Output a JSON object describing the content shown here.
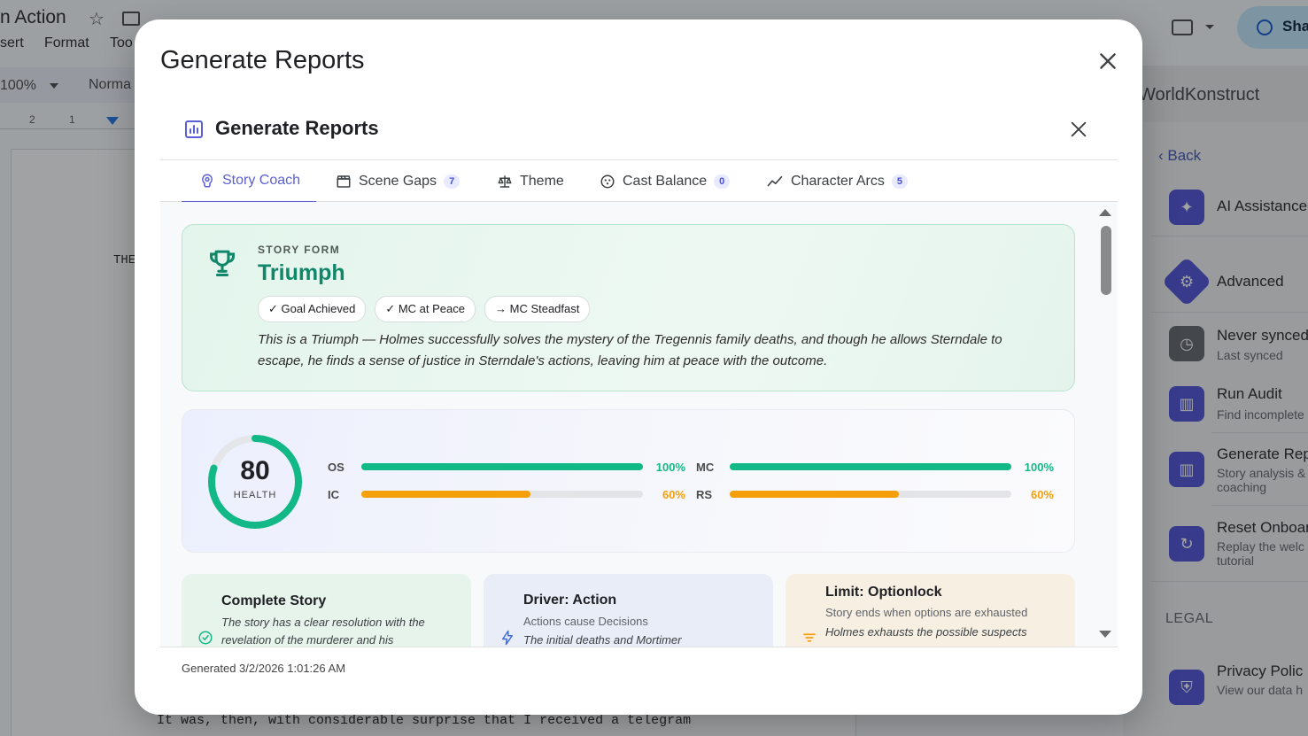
{
  "background": {
    "doc_title": "n Action",
    "menu": [
      "sert",
      "Format",
      "Too"
    ],
    "zoom": "100%",
    "style": "Norma",
    "ruler_numbers": [
      "2",
      "1"
    ],
    "page_line_1": "THE",
    "page_line_2": "It was, then, with considerable surprise that I received a telegram",
    "share_label": "Sha"
  },
  "side_panel": {
    "title": "WorldKonstruct",
    "back_label": "Back",
    "items": [
      {
        "label": "AI Assistance",
        "sub": ""
      },
      {
        "label": "Advanced",
        "sub": ""
      },
      {
        "label": "Never synced",
        "sub": "Last synced"
      },
      {
        "label": "Run Audit",
        "sub": "Find incomplete"
      },
      {
        "label": "Generate Rep",
        "sub": "Story analysis &",
        "sub2": "coaching"
      },
      {
        "label": "Reset Onboar",
        "sub": "Replay the welc",
        "sub2": "tutorial"
      },
      {
        "label": "Privacy Polic",
        "sub": "View our data h"
      }
    ],
    "legal_label": "LEGAL"
  },
  "modal": {
    "title": "Generate Reports",
    "inner_title": "Generate Reports",
    "tabs": [
      {
        "label": "Story Coach",
        "count": ""
      },
      {
        "label": "Scene Gaps",
        "count": "7"
      },
      {
        "label": "Theme",
        "count": ""
      },
      {
        "label": "Cast Balance",
        "count": "0"
      },
      {
        "label": "Character Arcs",
        "count": "5"
      }
    ],
    "story_form": {
      "label": "STORY FORM",
      "value": "Triumph",
      "badges": [
        "✓ Goal Achieved",
        "✓ MC at Peace",
        "→ MC Steadfast"
      ],
      "description": "This is a Triumph — Holmes successfully solves the mystery of the Tregennis family deaths, and though he allows Sterndale to escape, he finds a sense of justice in Sterndale's actions, leaving him at peace with the outcome."
    },
    "health": {
      "score": 80,
      "score_text": "80",
      "label": "HEALTH",
      "metrics": [
        {
          "key": "OS",
          "value": 100,
          "pct_text": "100%",
          "color": "#12b886"
        },
        {
          "key": "MC",
          "value": 100,
          "pct_text": "100%",
          "color": "#12b886"
        },
        {
          "key": "IC",
          "value": 60,
          "pct_text": "60%",
          "color": "#f59f0b"
        },
        {
          "key": "RS",
          "value": 60,
          "pct_text": "60%",
          "color": "#f59f0b"
        }
      ]
    },
    "cards": [
      {
        "title": "Complete Story",
        "sub": "",
        "desc": "The story has a clear resolution with the revelation of the murderer and his"
      },
      {
        "title": "Driver: Action",
        "sub": "Actions cause Decisions",
        "desc": "The initial deaths and Mortimer"
      },
      {
        "title": "Limit: Optionlock",
        "sub": "Story ends when options are exhausted",
        "desc": "Holmes exhausts the possible suspects"
      }
    ],
    "footer": "Generated 3/2/2026 1:01:26 AM"
  },
  "colors": {
    "accent": "#5a5fd6",
    "success": "#12b886",
    "warning": "#f59f0b",
    "form_green": "#11876a"
  }
}
